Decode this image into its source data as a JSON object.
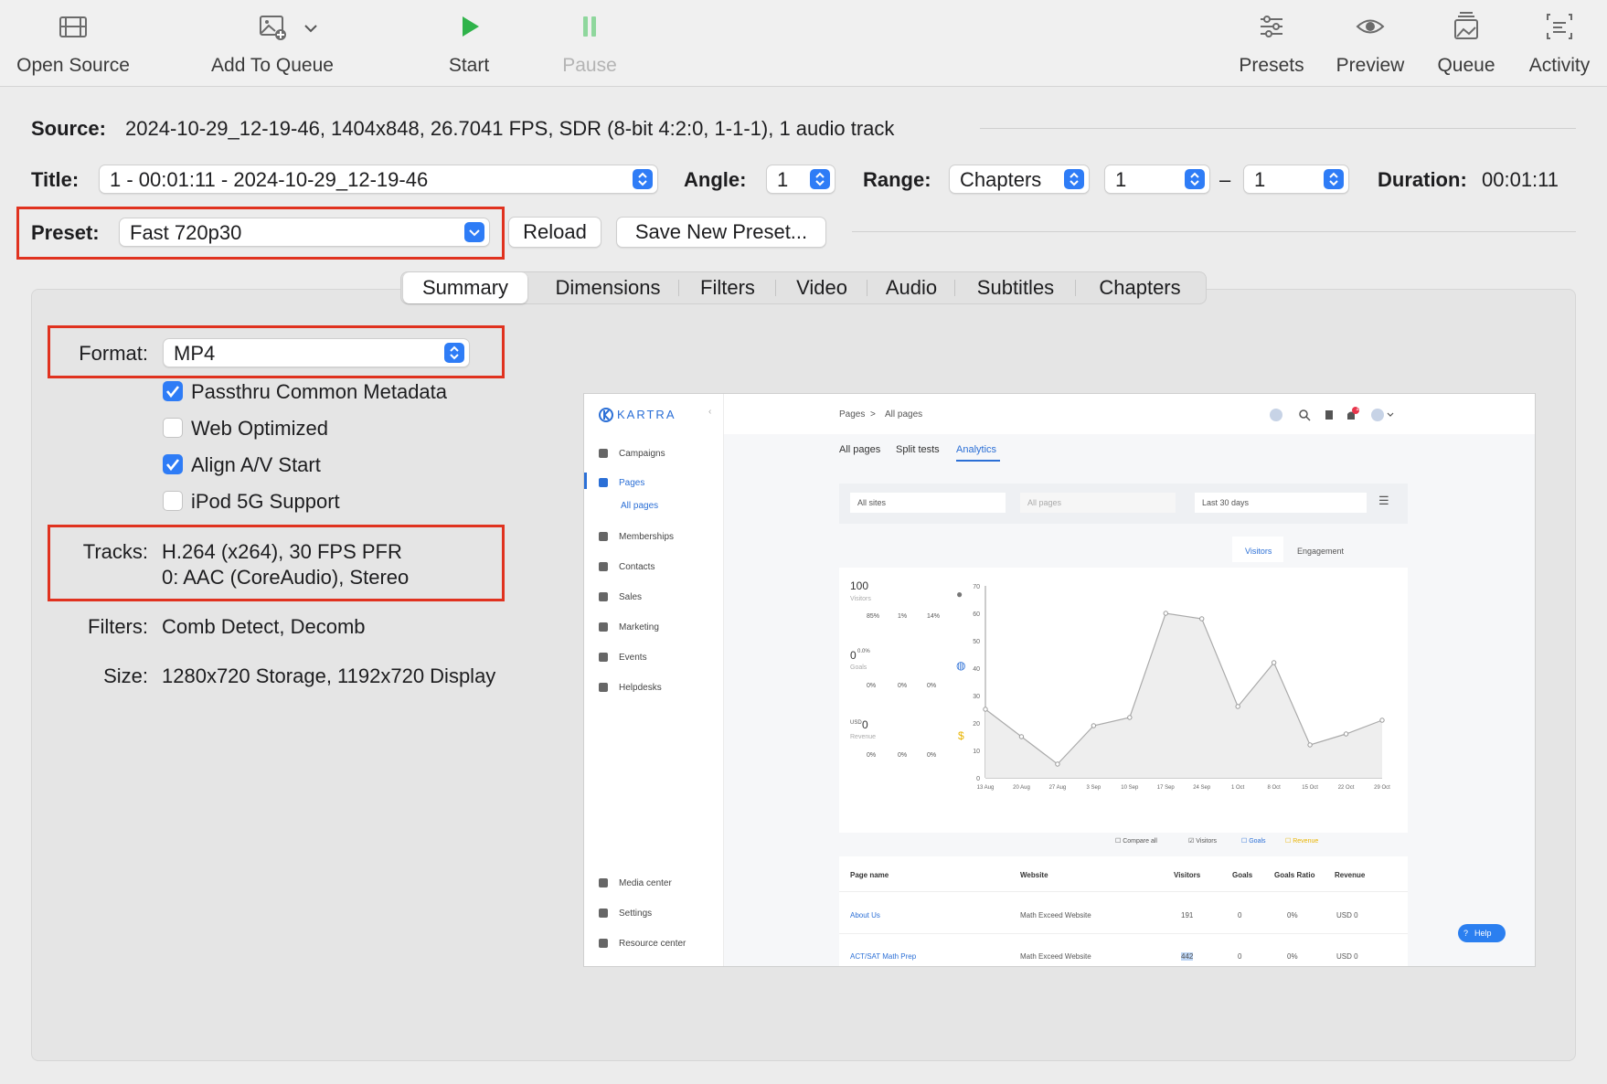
{
  "toolbar": {
    "open_source": "Open Source",
    "add_to_queue": "Add To Queue",
    "start": "Start",
    "pause": "Pause",
    "presets": "Presets",
    "preview": "Preview",
    "queue": "Queue",
    "activity": "Activity"
  },
  "source": {
    "label": "Source:",
    "value": "2024-10-29_12-19-46, 1404x848, 26.7041 FPS, SDR (8-bit 4:2:0, 1-1-1), 1 audio track"
  },
  "title_row": {
    "title_label": "Title:",
    "title_value": "1 - 00:01:11 - 2024-10-29_12-19-46",
    "angle_label": "Angle:",
    "angle_value": "1",
    "range_label": "Range:",
    "range_type": "Chapters",
    "range_start": "1",
    "range_dash": "–",
    "range_end": "1",
    "duration_label": "Duration:",
    "duration_value": "00:01:11"
  },
  "preset_row": {
    "label": "Preset:",
    "value": "Fast 720p30",
    "reload": "Reload",
    "save_new": "Save New Preset..."
  },
  "tabs": [
    "Summary",
    "Dimensions",
    "Filters",
    "Video",
    "Audio",
    "Subtitles",
    "Chapters"
  ],
  "summary": {
    "format_label": "Format:",
    "format_value": "MP4",
    "options": [
      {
        "label": "Passthru Common Metadata",
        "checked": true
      },
      {
        "label": "Web Optimized",
        "checked": false
      },
      {
        "label": "Align A/V Start",
        "checked": true
      },
      {
        "label": "iPod 5G Support",
        "checked": false
      }
    ],
    "tracks_label": "Tracks:",
    "tracks_line1": "H.264 (x264), 30 FPS PFR",
    "tracks_line2": "0: AAC (CoreAudio), Stereo",
    "filters_label": "Filters:",
    "filters_value": "Comb Detect, Decomb",
    "size_label": "Size:",
    "size_value": "1280x720 Storage, 1192x720 Display"
  },
  "preview_frame": {
    "brand": "KARTRA",
    "sidebar": [
      "Campaigns",
      "Pages",
      "All pages",
      "Memberships",
      "Contacts",
      "Sales",
      "Marketing",
      "Events",
      "Helpdesks"
    ],
    "sidebar_bottom": [
      "Media center",
      "Settings",
      "Resource center"
    ],
    "breadcrumb_root": "Pages",
    "breadcrumb_sep": ">",
    "breadcrumb_leaf": "All pages",
    "subtabs": [
      "All pages",
      "Split tests",
      "Analytics"
    ],
    "filters": [
      "All sites",
      "All pages",
      "Last 30 days"
    ],
    "chart_tabs": [
      "Visitors",
      "Engagement"
    ],
    "stats": [
      {
        "value": "100",
        "label": "Visitors",
        "percents": [
          "85%",
          "1%",
          "14%"
        ]
      },
      {
        "value": "0",
        "sup": "0.0%",
        "label": "Goals",
        "percents": [
          "0%",
          "0%",
          "0%"
        ]
      },
      {
        "value": "0",
        "prefix": "USD",
        "label": "Revenue",
        "percents": [
          "0%",
          "0%",
          "0%"
        ]
      }
    ],
    "legend": [
      "Compare all",
      "Visitors",
      "Goals",
      "Revenue"
    ],
    "table_headers": [
      "Page name",
      "Website",
      "Visitors",
      "Goals",
      "Goals Ratio",
      "Revenue"
    ],
    "rows": [
      [
        "About Us",
        "Math Exceed Website",
        "191",
        "0",
        "0%",
        "USD 0"
      ],
      [
        "ACT/SAT Math Prep",
        "Math Exceed Website",
        "442",
        "0",
        "0%",
        "USD 0"
      ]
    ],
    "help": "Help",
    "notif_count": "1"
  },
  "chart_data": {
    "type": "line",
    "categories": [
      "13 Aug",
      "20 Aug",
      "27 Aug",
      "3 Sep",
      "10 Sep",
      "17 Sep",
      "24 Sep",
      "1 Oct",
      "8 Oct",
      "15 Oct",
      "22 Oct",
      "29 Oct"
    ],
    "series": [
      {
        "name": "Visitors",
        "values": [
          25,
          15,
          5,
          19,
          22,
          60,
          58,
          26,
          42,
          12,
          16,
          21
        ]
      }
    ],
    "yticks": [
      "0",
      "10",
      "20",
      "30",
      "40",
      "50",
      "60",
      "70"
    ],
    "ylim": [
      0,
      70
    ],
    "grid": false,
    "legend": "bottom-right"
  }
}
